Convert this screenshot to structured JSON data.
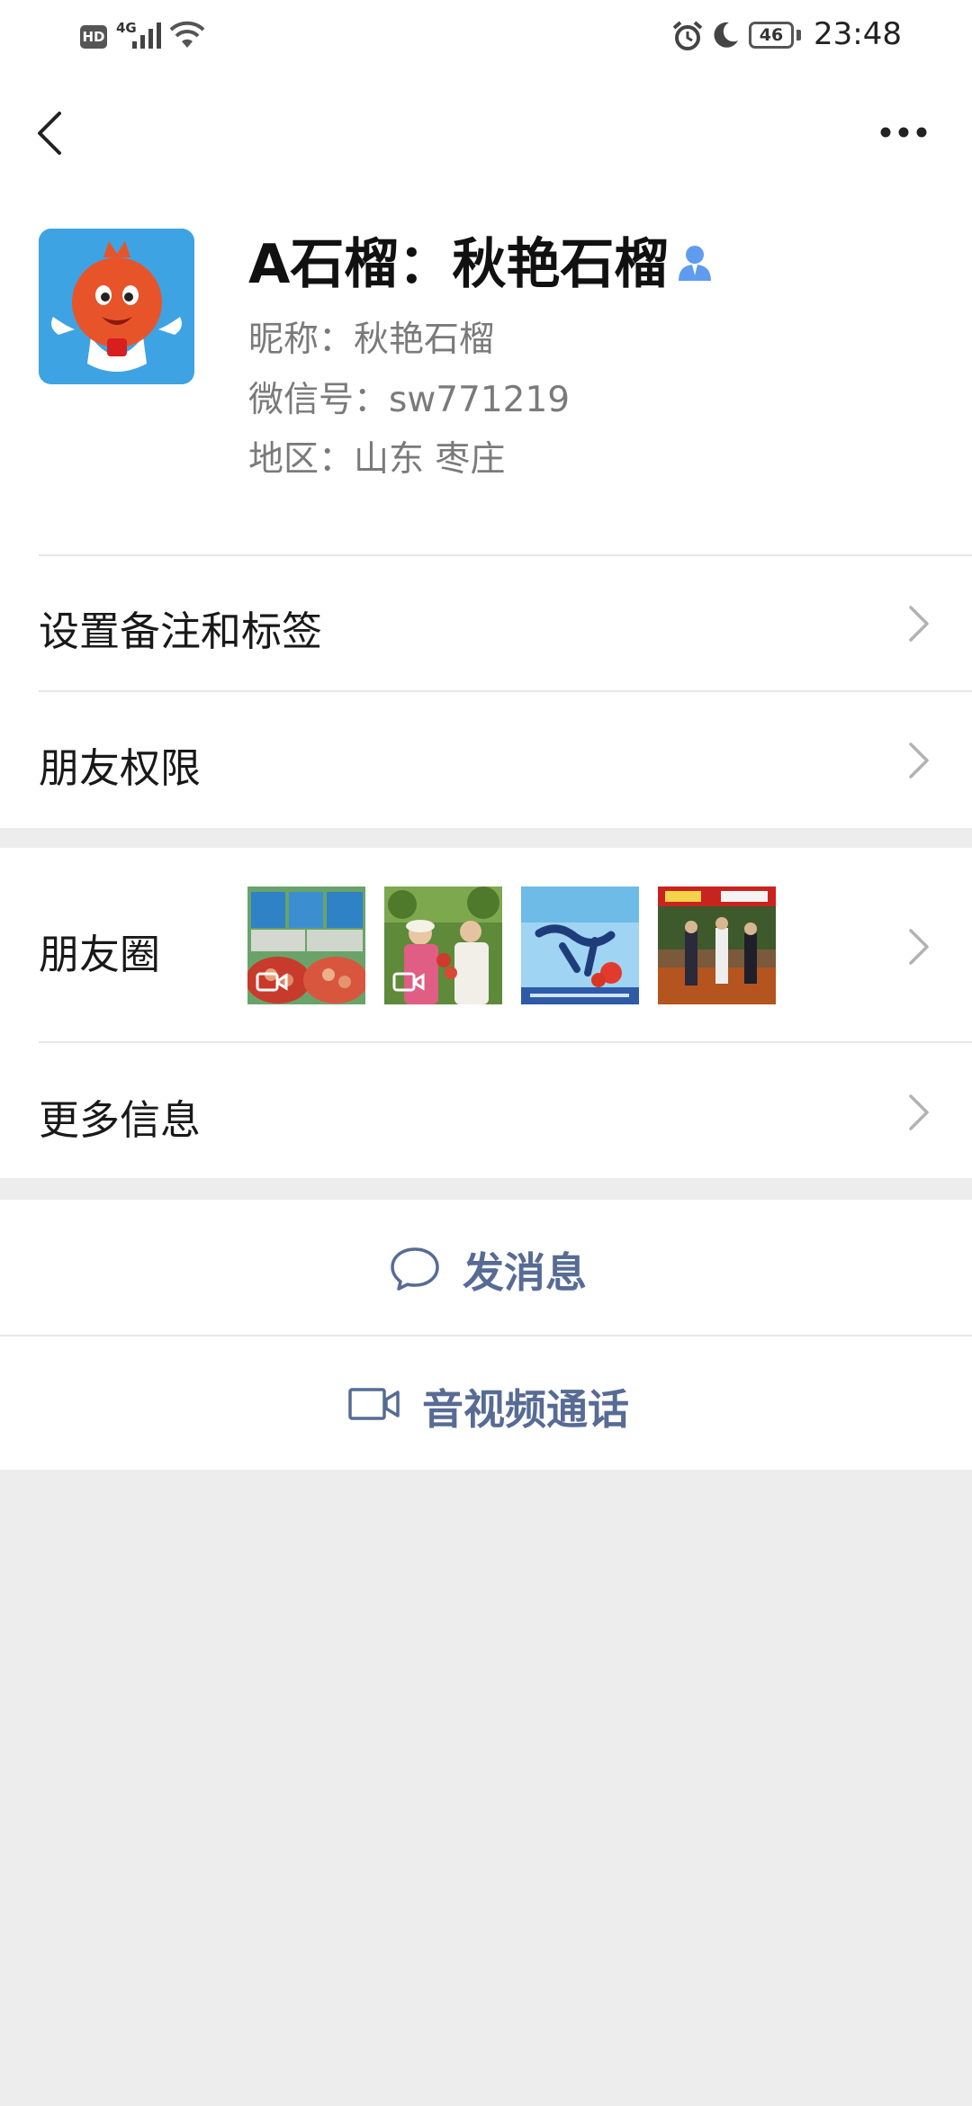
{
  "status_bar": {
    "hd_label": "HD",
    "network_label": "4G",
    "battery_level": "46",
    "time": "23:48",
    "icons": [
      "signal-icon",
      "wifi-icon",
      "alarm-icon",
      "moon-icon",
      "battery-icon"
    ]
  },
  "nav": {
    "back_icon": "back-icon",
    "more_icon": "more-icon"
  },
  "profile": {
    "display_name": "A石榴：秋艳石榴",
    "nickname": "昵称：秋艳石榴",
    "wechat_id": "微信号：sw771219",
    "region": "地区：山东  枣庄",
    "badge_icon": "user-badge-icon"
  },
  "menu": {
    "remark_tags_label": "设置备注和标签",
    "friend_permissions_label": "朋友权限",
    "moments_label": "朋友圈",
    "more_info_label": "更多信息"
  },
  "moments_thumbnails": [
    {
      "name": "pomegranate-crates-photo",
      "has_video": true
    },
    {
      "name": "orchard-women-photo",
      "has_video": true
    },
    {
      "name": "shiliu-sign-photo",
      "has_video": false
    },
    {
      "name": "market-street-photo",
      "has_video": false
    }
  ],
  "actions": {
    "send_message_label": "发消息",
    "video_call_label": "音视频通话"
  },
  "colors": {
    "background": "#ededed",
    "card": "#ffffff",
    "link_blue": "#576b95",
    "badge_blue": "#5f9cef"
  }
}
